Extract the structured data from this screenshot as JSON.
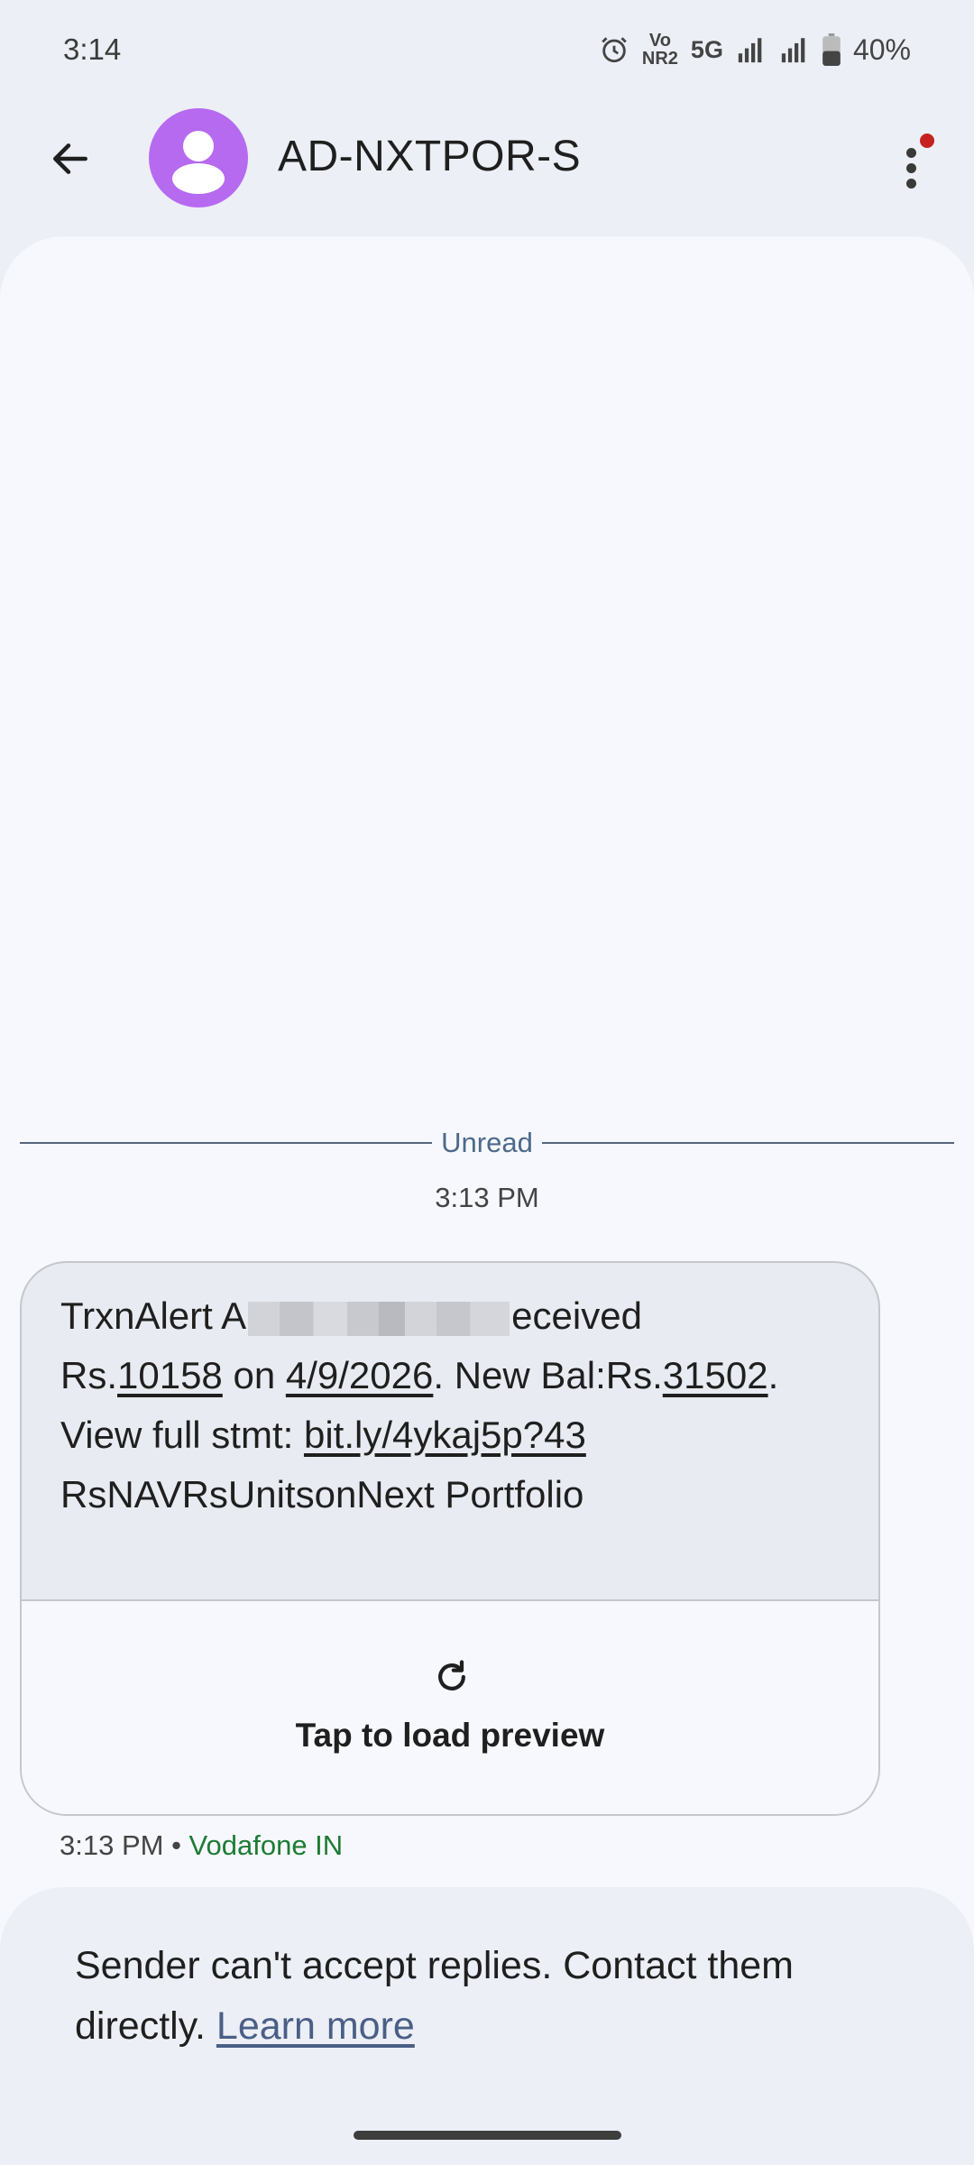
{
  "status_bar": {
    "time": "3:14",
    "network_labels": [
      "Vo",
      "NR2",
      "5G"
    ],
    "battery": "40%",
    "icons": [
      "alarm-icon",
      "volte-icon",
      "signal-icon",
      "signal-icon",
      "battery-icon"
    ]
  },
  "app_bar": {
    "contact_name": "AD-NXTPOR-S",
    "avatar_color": "#b66af0",
    "icons": [
      "back-arrow-icon",
      "more-vert-icon"
    ]
  },
  "conversation": {
    "unread_label": "Unread",
    "timestamp": "3:13 PM",
    "message": {
      "prefix": "TrxnAlert A",
      "suffix": "eceived",
      "rs_prefix": "Rs.",
      "amount": "10158",
      "on": " on ",
      "date": "4/9/2026",
      "new_bal": ". New Bal:Rs.",
      "balance": "31502",
      "period": ".",
      "stmt_label": "View full stmt: ",
      "link": "bit.ly/4ykaj5p?43",
      "tail": "RsNAVRsUnitsonNext Portfolio"
    },
    "preview_label": "Tap to load preview",
    "meta_time": "3:13 PM",
    "meta_separator": " • ",
    "carrier": "Vodafone IN",
    "carrier_color": "#1e7b34"
  },
  "notice": {
    "text": "Sender can't accept replies. Contact them directly. ",
    "learn_more": "Learn more"
  }
}
